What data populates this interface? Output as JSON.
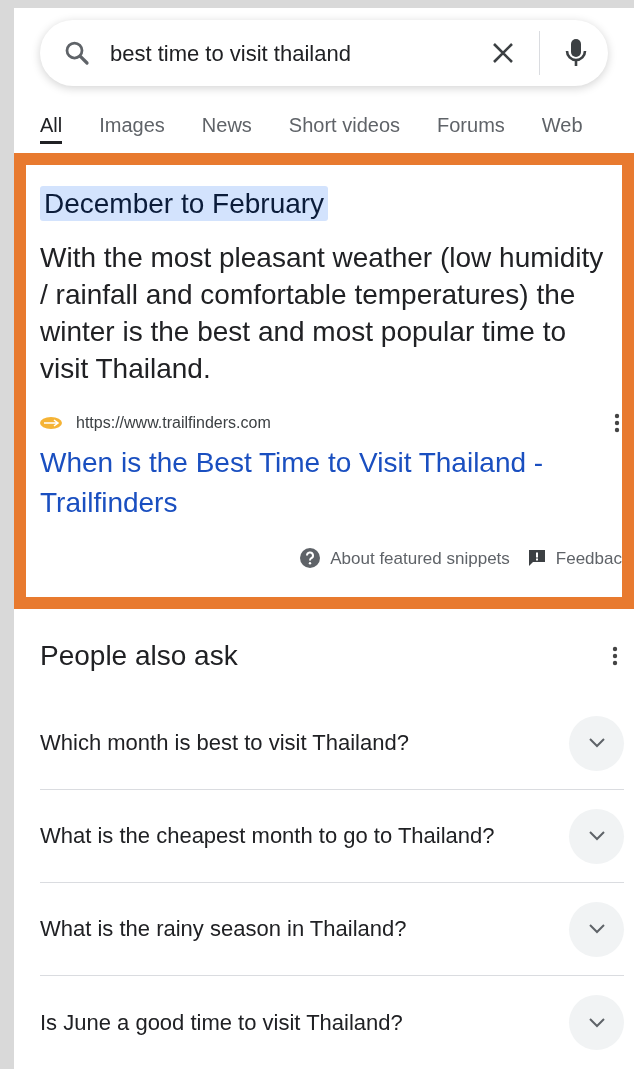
{
  "search": {
    "value": "best time to visit thailand"
  },
  "tabs": [
    {
      "label": "All",
      "selected": true
    },
    {
      "label": "Images",
      "selected": false
    },
    {
      "label": "News",
      "selected": false
    },
    {
      "label": "Short videos",
      "selected": false
    },
    {
      "label": "Forums",
      "selected": false
    },
    {
      "label": "Web",
      "selected": false
    }
  ],
  "featured_snippet": {
    "answer": "December to February",
    "text": "With the most pleasant weather (low humidity / rainfall and comfortable temperatures) the winter is the best and most popular time to visit Thailand.",
    "source_url": "https://www.trailfinders.com",
    "link_title": "When is the Best Time to Visit Thailand - Trailfinders",
    "about": "About featured snippets",
    "feedback": "Feedbac"
  },
  "people_also_ask": {
    "title": "People also ask",
    "questions": [
      {
        "text": "Which month is best to visit Thailand?",
        "expanded": false
      },
      {
        "text": "What is the cheapest month to go to Thailand?",
        "expanded": false
      },
      {
        "text": "What is the rainy season in Thailand?",
        "expanded": false
      },
      {
        "text": "Is June a good time to visit Thailand?",
        "expanded": false
      }
    ]
  }
}
